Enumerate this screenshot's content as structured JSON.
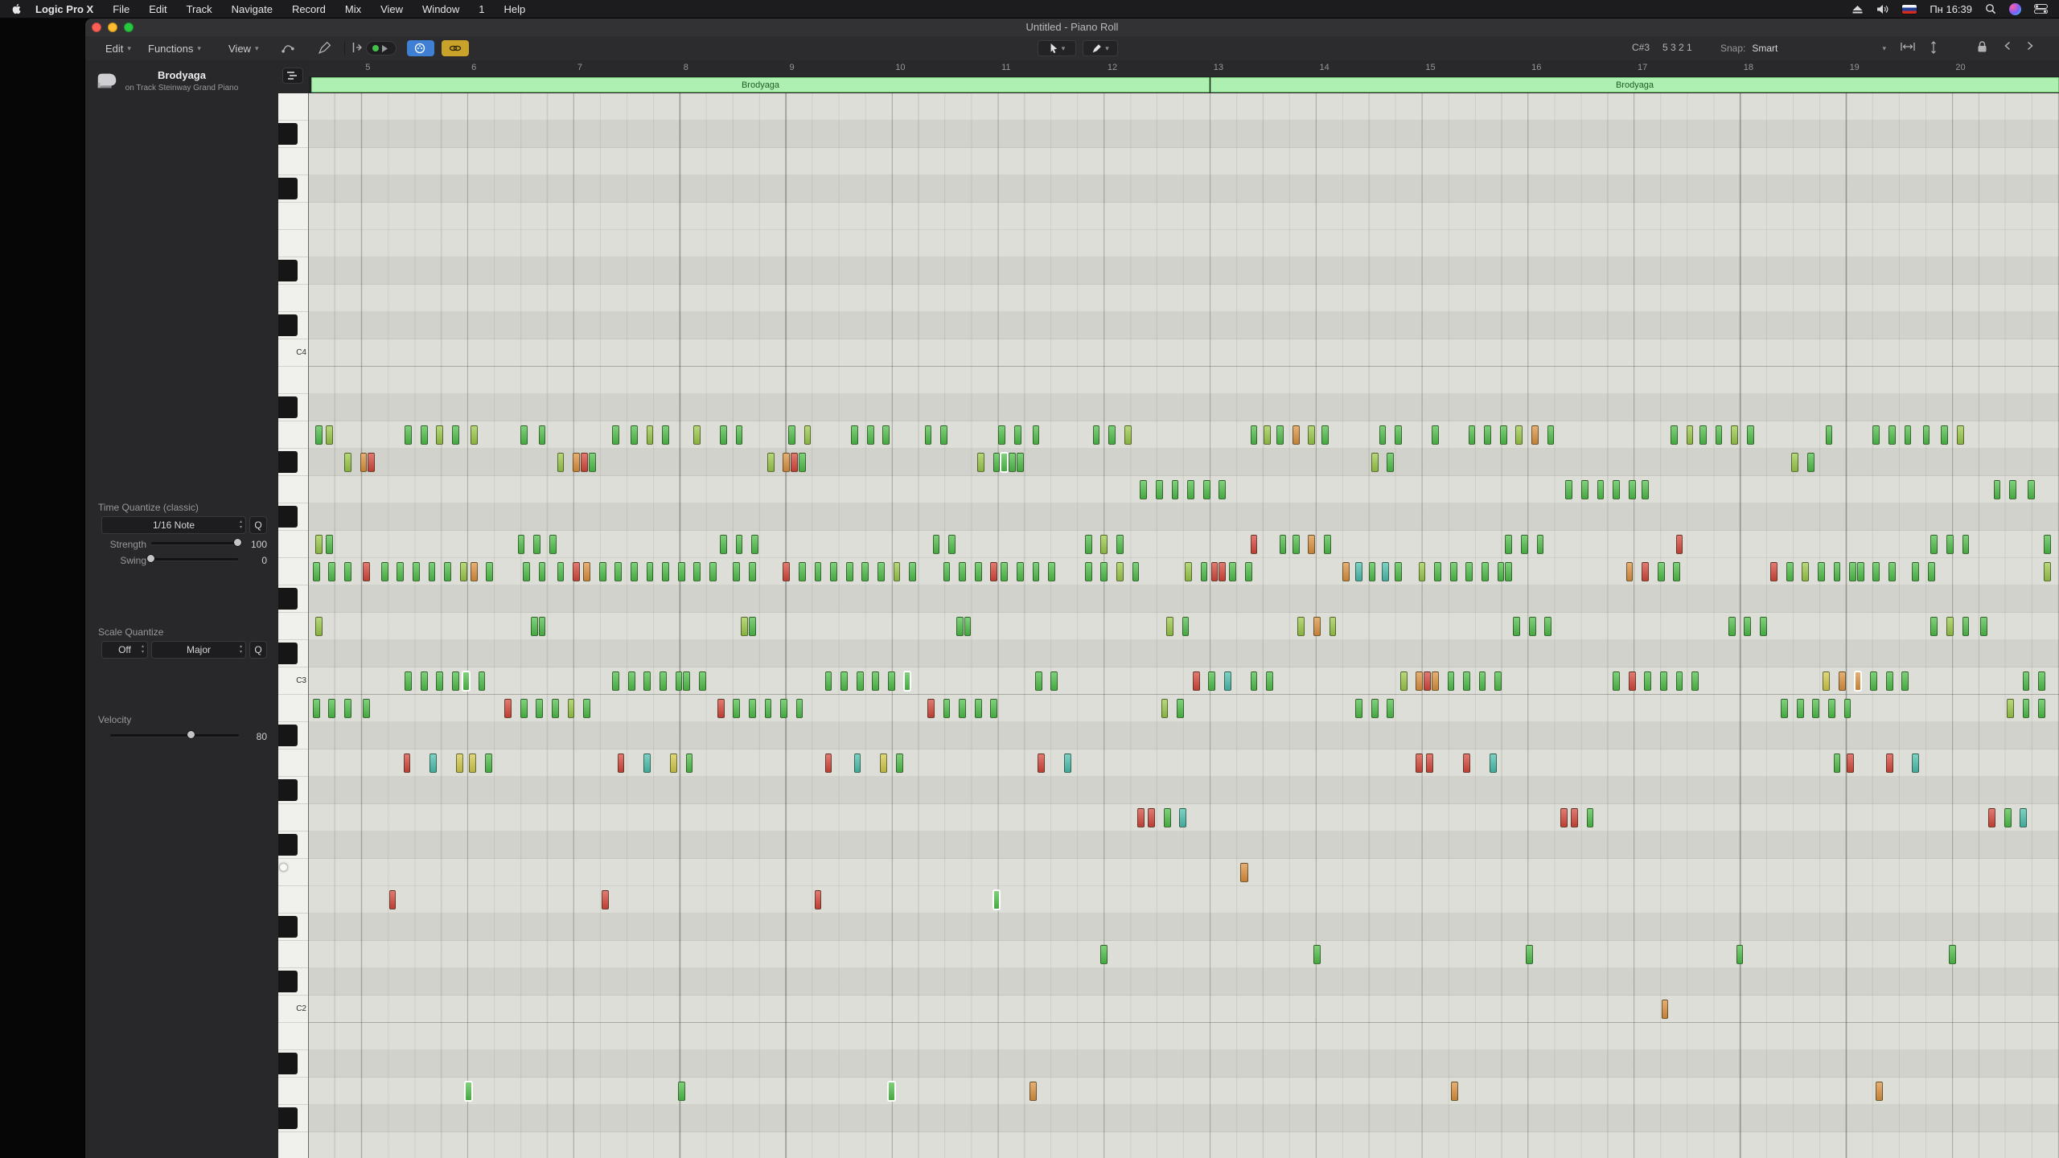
{
  "menubar": {
    "app_name": "Logic Pro X",
    "items": [
      "File",
      "Edit",
      "Track",
      "Navigate",
      "Record",
      "Mix",
      "View",
      "Window",
      "1",
      "Help"
    ],
    "status": {
      "time": "Пн 16:39"
    }
  },
  "window": {
    "title": "Untitled - Piano Roll"
  },
  "toolbar": {
    "menus": {
      "edit": "Edit",
      "functions": "Functions",
      "view": "View"
    },
    "position_display": {
      "pitch": "C#3",
      "position": "5 3 2 1"
    },
    "snap": {
      "label": "Snap:",
      "value": "Smart"
    }
  },
  "inspector": {
    "track": {
      "name": "Brodyaga",
      "subtitle": "on Track Steinway Grand Piano"
    },
    "time_quantize": {
      "title": "Time Quantize (classic)",
      "value": "1/16 Note",
      "q": "Q",
      "strength": {
        "label": "Strength",
        "value": "100"
      },
      "swing": {
        "label": "Swing",
        "value": "0"
      }
    },
    "scale_quantize": {
      "title": "Scale Quantize",
      "root": "Off",
      "scale": "Major",
      "q": "Q"
    },
    "velocity": {
      "label": "Velocity",
      "value": "80"
    }
  },
  "ruler": {
    "bars": [
      5,
      6,
      7,
      8,
      9,
      10,
      11,
      12,
      13,
      14,
      15,
      16,
      17,
      18,
      19,
      20
    ]
  },
  "regions": [
    {
      "label": "Brodyaga"
    },
    {
      "label": "Brodyaga"
    }
  ],
  "keyboard": {
    "c_labels": [
      "C4",
      "C3",
      "C2"
    ],
    "top_pitch": "A4",
    "row_count": 39
  },
  "colors": {
    "note_palette": [
      "#4fbf4a",
      "#9cc94a",
      "#d3c94b",
      "#dd9140",
      "#d6473c",
      "#4cbfae"
    ],
    "region": "#aef0b2",
    "accent_blue": "#3f7fd4",
    "accent_yellow": "#c9a229"
  },
  "notes": [
    [
      5,
      12,
      0
    ],
    [
      13,
      12,
      1
    ],
    [
      73,
      12,
      0
    ],
    [
      85,
      12,
      0
    ],
    [
      97,
      12,
      1
    ],
    [
      109,
      12,
      0
    ],
    [
      123,
      12,
      1
    ],
    [
      161,
      12,
      0
    ],
    [
      175,
      12,
      0
    ],
    [
      231,
      12,
      0
    ],
    [
      245,
      12,
      0
    ],
    [
      257,
      12,
      1
    ],
    [
      269,
      12,
      0
    ],
    [
      293,
      12,
      1
    ],
    [
      313,
      12,
      0
    ],
    [
      325,
      12,
      0
    ],
    [
      365,
      12,
      0
    ],
    [
      377,
      12,
      1
    ],
    [
      413,
      12,
      0
    ],
    [
      425,
      12,
      0
    ],
    [
      437,
      12,
      0
    ],
    [
      469,
      12,
      0
    ],
    [
      481,
      12,
      0
    ],
    [
      525,
      12,
      0
    ],
    [
      537,
      12,
      0
    ],
    [
      551,
      12,
      0
    ],
    [
      597,
      12,
      0
    ],
    [
      609,
      12,
      0
    ],
    [
      621,
      12,
      1
    ],
    [
      717,
      12,
      0
    ],
    [
      727,
      12,
      1
    ],
    [
      737,
      12,
      0
    ],
    [
      749,
      12,
      3
    ],
    [
      761,
      12,
      1
    ],
    [
      771,
      12,
      0
    ],
    [
      815,
      12,
      0
    ],
    [
      827,
      12,
      0
    ],
    [
      855,
      12,
      0
    ],
    [
      883,
      12,
      0
    ],
    [
      895,
      12,
      0
    ],
    [
      907,
      12,
      0
    ],
    [
      919,
      12,
      1
    ],
    [
      931,
      12,
      3
    ],
    [
      943,
      12,
      0
    ],
    [
      1037,
      12,
      0
    ],
    [
      1049,
      12,
      1
    ],
    [
      1059,
      12,
      0
    ],
    [
      1071,
      12,
      0
    ],
    [
      1083,
      12,
      1
    ],
    [
      1095,
      12,
      0
    ],
    [
      1155,
      12,
      0
    ],
    [
      1191,
      12,
      0
    ],
    [
      1203,
      12,
      0
    ],
    [
      1215,
      12,
      0
    ],
    [
      1229,
      12,
      0
    ],
    [
      1243,
      12,
      0
    ],
    [
      1255,
      12,
      1
    ],
    [
      27,
      13,
      1
    ],
    [
      39,
      13,
      3
    ],
    [
      45,
      13,
      4
    ],
    [
      189,
      13,
      1
    ],
    [
      201,
      13,
      3
    ],
    [
      207,
      13,
      4
    ],
    [
      213,
      13,
      0
    ],
    [
      349,
      13,
      1
    ],
    [
      361,
      13,
      3
    ],
    [
      367,
      13,
      4
    ],
    [
      373,
      13,
      0
    ],
    [
      509,
      13,
      1
    ],
    [
      521,
      13,
      0
    ],
    [
      527,
      13,
      0,
      6,
      1
    ],
    [
      533,
      13,
      0
    ],
    [
      539,
      13,
      0
    ],
    [
      809,
      13,
      1
    ],
    [
      821,
      13,
      0
    ],
    [
      1129,
      13,
      1
    ],
    [
      1141,
      13,
      0
    ],
    [
      633,
      14,
      0
    ],
    [
      645,
      14,
      0
    ],
    [
      657,
      14,
      0
    ],
    [
      669,
      14,
      0
    ],
    [
      681,
      14,
      0
    ],
    [
      693,
      14,
      0
    ],
    [
      957,
      14,
      0
    ],
    [
      969,
      14,
      0
    ],
    [
      981,
      14,
      0
    ],
    [
      993,
      14,
      0
    ],
    [
      1005,
      14,
      0
    ],
    [
      1015,
      14,
      0
    ],
    [
      1283,
      14,
      0
    ],
    [
      1295,
      14,
      0
    ],
    [
      1309,
      14,
      0
    ],
    [
      5,
      16,
      1
    ],
    [
      13,
      16,
      0
    ],
    [
      159,
      16,
      0
    ],
    [
      171,
      16,
      0
    ],
    [
      183,
      16,
      0
    ],
    [
      313,
      16,
      0
    ],
    [
      325,
      16,
      0
    ],
    [
      337,
      16,
      0
    ],
    [
      475,
      16,
      0
    ],
    [
      487,
      16,
      0
    ],
    [
      591,
      16,
      0
    ],
    [
      603,
      16,
      1
    ],
    [
      615,
      16,
      0
    ],
    [
      717,
      16,
      4
    ],
    [
      739,
      16,
      0
    ],
    [
      749,
      16,
      0
    ],
    [
      761,
      16,
      3
    ],
    [
      773,
      16,
      0
    ],
    [
      911,
      16,
      0
    ],
    [
      923,
      16,
      0
    ],
    [
      935,
      16,
      0
    ],
    [
      1041,
      16,
      4
    ],
    [
      1235,
      16,
      0
    ],
    [
      1247,
      16,
      0
    ],
    [
      1259,
      16,
      0
    ],
    [
      1321,
      16,
      0
    ],
    [
      3,
      17,
      0
    ],
    [
      15,
      17,
      0
    ],
    [
      27,
      17,
      0
    ],
    [
      41,
      17,
      4
    ],
    [
      55,
      17,
      0
    ],
    [
      67,
      17,
      0
    ],
    [
      79,
      17,
      0
    ],
    [
      91,
      17,
      0
    ],
    [
      103,
      17,
      0
    ],
    [
      115,
      17,
      1
    ],
    [
      123,
      17,
      3
    ],
    [
      135,
      17,
      0
    ],
    [
      163,
      17,
      0
    ],
    [
      175,
      17,
      0
    ],
    [
      189,
      17,
      0
    ],
    [
      201,
      17,
      4
    ],
    [
      209,
      17,
      3
    ],
    [
      221,
      17,
      0
    ],
    [
      233,
      17,
      0
    ],
    [
      245,
      17,
      0
    ],
    [
      257,
      17,
      0
    ],
    [
      269,
      17,
      0
    ],
    [
      281,
      17,
      0
    ],
    [
      293,
      17,
      0
    ],
    [
      305,
      17,
      0
    ],
    [
      323,
      17,
      0
    ],
    [
      335,
      17,
      0
    ],
    [
      361,
      17,
      4
    ],
    [
      373,
      17,
      0
    ],
    [
      385,
      17,
      0
    ],
    [
      397,
      17,
      0
    ],
    [
      409,
      17,
      0
    ],
    [
      421,
      17,
      0
    ],
    [
      433,
      17,
      0
    ],
    [
      445,
      17,
      1
    ],
    [
      457,
      17,
      0
    ],
    [
      483,
      17,
      0
    ],
    [
      495,
      17,
      0
    ],
    [
      507,
      17,
      0
    ],
    [
      519,
      17,
      4
    ],
    [
      527,
      17,
      0
    ],
    [
      539,
      17,
      0
    ],
    [
      551,
      17,
      0
    ],
    [
      563,
      17,
      0
    ],
    [
      591,
      17,
      0
    ],
    [
      603,
      17,
      0
    ],
    [
      615,
      17,
      1
    ],
    [
      627,
      17,
      0
    ],
    [
      667,
      17,
      1
    ],
    [
      679,
      17,
      0
    ],
    [
      687,
      17,
      4
    ],
    [
      693,
      17,
      4
    ],
    [
      701,
      17,
      0
    ],
    [
      713,
      17,
      0
    ],
    [
      787,
      17,
      3
    ],
    [
      797,
      17,
      5
    ],
    [
      807,
      17,
      0
    ],
    [
      817,
      17,
      5
    ],
    [
      827,
      17,
      0
    ],
    [
      845,
      17,
      1
    ],
    [
      857,
      17,
      0
    ],
    [
      869,
      17,
      0
    ],
    [
      881,
      17,
      0
    ],
    [
      893,
      17,
      0
    ],
    [
      905,
      17,
      0
    ],
    [
      911,
      17,
      0
    ],
    [
      1003,
      17,
      3
    ],
    [
      1015,
      17,
      4
    ],
    [
      1027,
      17,
      0
    ],
    [
      1039,
      17,
      0
    ],
    [
      1113,
      17,
      4
    ],
    [
      1125,
      17,
      0
    ],
    [
      1137,
      17,
      1
    ],
    [
      1149,
      17,
      0
    ],
    [
      1161,
      17,
      0
    ],
    [
      1173,
      17,
      0
    ],
    [
      1179,
      17,
      0
    ],
    [
      1191,
      17,
      0
    ],
    [
      1203,
      17,
      0
    ],
    [
      1221,
      17,
      0
    ],
    [
      1233,
      17,
      0
    ],
    [
      1321,
      17,
      1
    ],
    [
      5,
      19,
      1
    ],
    [
      169,
      19,
      0
    ],
    [
      175,
      19,
      0
    ],
    [
      329,
      19,
      1
    ],
    [
      335,
      19,
      0
    ],
    [
      493,
      19,
      0
    ],
    [
      499,
      19,
      0
    ],
    [
      653,
      19,
      1
    ],
    [
      665,
      19,
      0
    ],
    [
      753,
      19,
      1
    ],
    [
      765,
      19,
      3
    ],
    [
      777,
      19,
      1
    ],
    [
      917,
      19,
      0
    ],
    [
      929,
      19,
      0
    ],
    [
      941,
      19,
      0
    ],
    [
      1081,
      19,
      0
    ],
    [
      1093,
      19,
      0
    ],
    [
      1105,
      19,
      0
    ],
    [
      1235,
      19,
      0
    ],
    [
      1247,
      19,
      1
    ],
    [
      1259,
      19,
      0
    ],
    [
      1273,
      19,
      0
    ],
    [
      73,
      21,
      0
    ],
    [
      85,
      21,
      0
    ],
    [
      97,
      21,
      0
    ],
    [
      109,
      21,
      0
    ],
    [
      117,
      21,
      0,
      6,
      1
    ],
    [
      129,
      21,
      0
    ],
    [
      231,
      21,
      0
    ],
    [
      243,
      21,
      0
    ],
    [
      255,
      21,
      0
    ],
    [
      267,
      21,
      0
    ],
    [
      279,
      21,
      0
    ],
    [
      285,
      21,
      0
    ],
    [
      297,
      21,
      0
    ],
    [
      393,
      21,
      0
    ],
    [
      405,
      21,
      0
    ],
    [
      417,
      21,
      0
    ],
    [
      429,
      21,
      0
    ],
    [
      441,
      21,
      0
    ],
    [
      453,
      21,
      0,
      6,
      1
    ],
    [
      553,
      21,
      0
    ],
    [
      565,
      21,
      0
    ],
    [
      673,
      21,
      4
    ],
    [
      685,
      21,
      0
    ],
    [
      697,
      21,
      5
    ],
    [
      717,
      21,
      0
    ],
    [
      729,
      21,
      0
    ],
    [
      831,
      21,
      1
    ],
    [
      843,
      21,
      3
    ],
    [
      849,
      21,
      4
    ],
    [
      855,
      21,
      3
    ],
    [
      867,
      21,
      0
    ],
    [
      879,
      21,
      0
    ],
    [
      891,
      21,
      0
    ],
    [
      903,
      21,
      0
    ],
    [
      993,
      21,
      0
    ],
    [
      1005,
      21,
      4
    ],
    [
      1017,
      21,
      0
    ],
    [
      1029,
      21,
      0
    ],
    [
      1041,
      21,
      0
    ],
    [
      1053,
      21,
      0
    ],
    [
      1153,
      21,
      2
    ],
    [
      1165,
      21,
      3
    ],
    [
      1177,
      21,
      3,
      6,
      1
    ],
    [
      1189,
      21,
      0
    ],
    [
      1201,
      21,
      0
    ],
    [
      1213,
      21,
      0
    ],
    [
      1305,
      21,
      0
    ],
    [
      1317,
      21,
      0
    ],
    [
      3,
      22,
      0
    ],
    [
      15,
      22,
      0
    ],
    [
      27,
      22,
      0
    ],
    [
      41,
      22,
      0
    ],
    [
      149,
      22,
      4
    ],
    [
      161,
      22,
      0
    ],
    [
      173,
      22,
      0
    ],
    [
      185,
      22,
      0
    ],
    [
      197,
      22,
      1
    ],
    [
      209,
      22,
      0
    ],
    [
      311,
      22,
      4
    ],
    [
      323,
      22,
      0
    ],
    [
      335,
      22,
      0
    ],
    [
      347,
      22,
      0
    ],
    [
      359,
      22,
      0
    ],
    [
      371,
      22,
      0
    ],
    [
      471,
      22,
      4
    ],
    [
      483,
      22,
      0
    ],
    [
      495,
      22,
      0
    ],
    [
      507,
      22,
      0
    ],
    [
      519,
      22,
      0
    ],
    [
      649,
      22,
      1
    ],
    [
      661,
      22,
      0
    ],
    [
      797,
      22,
      0
    ],
    [
      809,
      22,
      0
    ],
    [
      821,
      22,
      0
    ],
    [
      1121,
      22,
      0
    ],
    [
      1133,
      22,
      0
    ],
    [
      1145,
      22,
      0
    ],
    [
      1157,
      22,
      0
    ],
    [
      1169,
      22,
      0
    ],
    [
      1293,
      22,
      1
    ],
    [
      1305,
      22,
      0
    ],
    [
      1317,
      22,
      0
    ],
    [
      72,
      24,
      4
    ],
    [
      92,
      24,
      5
    ],
    [
      112,
      24,
      2
    ],
    [
      122,
      24,
      2
    ],
    [
      134,
      24,
      0
    ],
    [
      235,
      24,
      4
    ],
    [
      255,
      24,
      5
    ],
    [
      275,
      24,
      2
    ],
    [
      287,
      24,
      0
    ],
    [
      393,
      24,
      4
    ],
    [
      415,
      24,
      5
    ],
    [
      435,
      24,
      2
    ],
    [
      447,
      24,
      0
    ],
    [
      555,
      24,
      4
    ],
    [
      575,
      24,
      5
    ],
    [
      843,
      24,
      4
    ],
    [
      851,
      24,
      4
    ],
    [
      879,
      24,
      4
    ],
    [
      899,
      24,
      5
    ],
    [
      1161,
      24,
      0
    ],
    [
      1171,
      24,
      4
    ],
    [
      1201,
      24,
      4
    ],
    [
      1221,
      24,
      5
    ],
    [
      631,
      26,
      4
    ],
    [
      639,
      26,
      4
    ],
    [
      651,
      26,
      0
    ],
    [
      663,
      26,
      5
    ],
    [
      953,
      26,
      4
    ],
    [
      961,
      26,
      4
    ],
    [
      973,
      26,
      0
    ],
    [
      1279,
      26,
      4
    ],
    [
      1291,
      26,
      0
    ],
    [
      1303,
      26,
      5
    ],
    [
      709,
      28,
      3,
      7
    ],
    [
      61,
      29,
      4
    ],
    [
      223,
      29,
      4
    ],
    [
      385,
      29,
      4
    ],
    [
      521,
      29,
      0,
      6,
      1
    ],
    [
      603,
      31,
      0
    ],
    [
      765,
      31,
      0
    ],
    [
      927,
      31,
      0
    ],
    [
      1087,
      31,
      0
    ],
    [
      1249,
      31,
      0
    ],
    [
      1030,
      33,
      3
    ],
    [
      119,
      36,
      0,
      6,
      1
    ],
    [
      281,
      36,
      0
    ],
    [
      441,
      36,
      0,
      6,
      1
    ],
    [
      549,
      36,
      3
    ],
    [
      870,
      36,
      3
    ],
    [
      1193,
      36,
      3
    ]
  ]
}
